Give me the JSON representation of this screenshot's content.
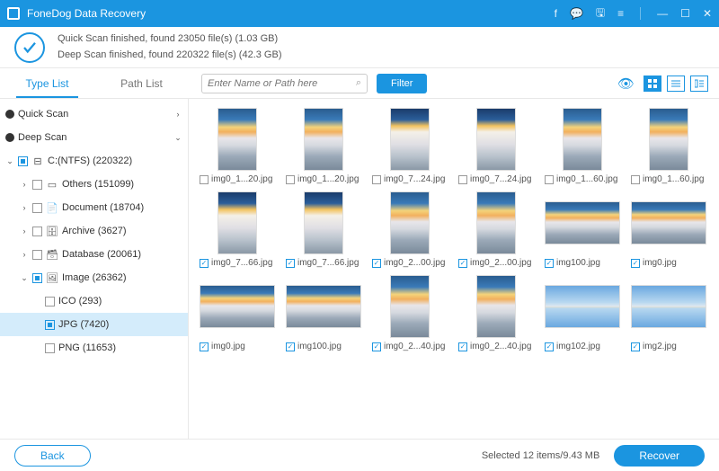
{
  "titlebar": {
    "title": "FoneDog Data Recovery"
  },
  "status": {
    "line1": "Quick Scan finished, found 23050 file(s) (1.03 GB)",
    "line2": "Deep Scan finished, found 220322 file(s) (42.3 GB)"
  },
  "tabs": {
    "typelist": "Type List",
    "pathlist": "Path List"
  },
  "search": {
    "placeholder": "Enter Name or Path here"
  },
  "filter": {
    "label": "Filter"
  },
  "tree": {
    "quickscan": "Quick Scan",
    "deepscan": "Deep Scan",
    "drive": "C:(NTFS) (220322)",
    "others": "Others (151099)",
    "document": "Document (18704)",
    "archive": "Archive (3627)",
    "database": "Database (20061)",
    "image": "Image (26362)",
    "ico": "ICO (293)",
    "jpg": "JPG (7420)",
    "png": "PNG (11653)"
  },
  "grid": [
    [
      {
        "name": "img0_1...20.jpg",
        "checked": false,
        "shape": "portrait",
        "style": "sky1"
      },
      {
        "name": "img0_1...20.jpg",
        "checked": false,
        "shape": "portrait",
        "style": "sky1"
      },
      {
        "name": "img0_7...24.jpg",
        "checked": false,
        "shape": "portrait",
        "style": "sky2"
      },
      {
        "name": "img0_7...24.jpg",
        "checked": false,
        "shape": "portrait",
        "style": "sky2"
      },
      {
        "name": "img0_1...60.jpg",
        "checked": false,
        "shape": "portrait",
        "style": "sky1"
      },
      {
        "name": "img0_1...60.jpg",
        "checked": false,
        "shape": "portrait",
        "style": "sky1"
      }
    ],
    [
      {
        "name": "img0_7...66.jpg",
        "checked": true,
        "shape": "portrait",
        "style": "sky2"
      },
      {
        "name": "img0_7...66.jpg",
        "checked": true,
        "shape": "portrait",
        "style": "sky2"
      },
      {
        "name": "img0_2...00.jpg",
        "checked": true,
        "shape": "portrait",
        "style": "sky1"
      },
      {
        "name": "img0_2...00.jpg",
        "checked": true,
        "shape": "portrait",
        "style": "sky1"
      },
      {
        "name": "img100.jpg",
        "checked": true,
        "shape": "landscape",
        "style": "sky1"
      },
      {
        "name": "img0.jpg",
        "checked": true,
        "shape": "landscape",
        "style": "sky1"
      }
    ],
    [
      {
        "name": "img0.jpg",
        "checked": true,
        "shape": "landscape",
        "style": "sky1"
      },
      {
        "name": "img100.jpg",
        "checked": true,
        "shape": "landscape",
        "style": "sky1"
      },
      {
        "name": "img0_2...40.jpg",
        "checked": true,
        "shape": "portrait",
        "style": "sky1"
      },
      {
        "name": "img0_2...40.jpg",
        "checked": true,
        "shape": "portrait",
        "style": "sky1"
      },
      {
        "name": "img102.jpg",
        "checked": true,
        "shape": "landscape",
        "style": "island"
      },
      {
        "name": "img2.jpg",
        "checked": true,
        "shape": "landscape",
        "style": "island"
      }
    ]
  ],
  "footer": {
    "back": "Back",
    "selected": "Selected 12 items/9.43 MB",
    "recover": "Recover"
  }
}
